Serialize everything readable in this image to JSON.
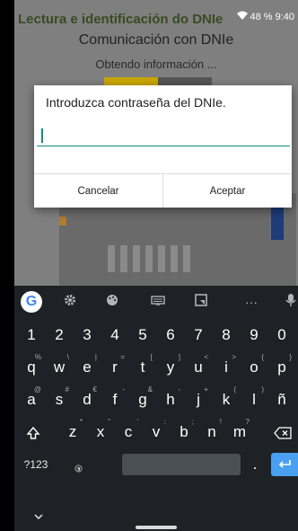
{
  "status_bar": {
    "app_title": "Lectura e identificación do DNIe",
    "battery": "48 %",
    "time": "9:40"
  },
  "background": {
    "title": "Comunicación con DNIe",
    "subtitle": "Obtendo información ..."
  },
  "dialog": {
    "title": "Introduzca contraseña del DNIe.",
    "input_value": "",
    "cancel_label": "Cancelar",
    "accept_label": "Aceptar"
  },
  "keyboard": {
    "toolbar_icons": [
      "google-icon",
      "gear-icon",
      "palette-icon",
      "keyboard-icon",
      "screenshot-icon",
      "more-icon",
      "mic-icon"
    ],
    "more_label": "···",
    "row1": [
      "1",
      "2",
      "3",
      "4",
      "5",
      "6",
      "7",
      "8",
      "9",
      "0"
    ],
    "row2": [
      "q",
      "w",
      "e",
      "r",
      "t",
      "y",
      "u",
      "i",
      "o",
      "p"
    ],
    "row2_hints": [
      "%",
      "\\",
      "|",
      "=",
      "[",
      "]",
      "<",
      ">",
      "{",
      "}"
    ],
    "row3": [
      "a",
      "s",
      "d",
      "f",
      "g",
      "h",
      "j",
      "k",
      "l",
      "ñ"
    ],
    "row3_hints": [
      "@",
      "#",
      "€",
      "-",
      "&",
      "-",
      "+",
      "(",
      ")",
      ""
    ],
    "row4": [
      "z",
      "x",
      "c",
      "v",
      "b",
      "n",
      "m"
    ],
    "row4_hints": [
      "*",
      "\"",
      "'",
      ":",
      ";",
      "!",
      "?"
    ],
    "sym_label": "?123",
    "comma": ",",
    "period": ".",
    "accent_color": "#4aa0f0"
  }
}
